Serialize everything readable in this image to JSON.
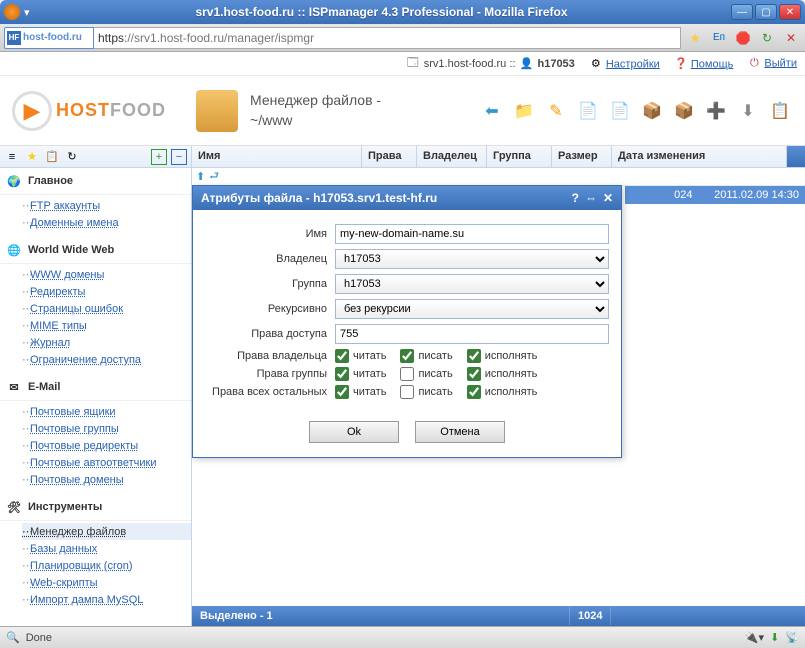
{
  "window": {
    "title": "srv1.host-food.ru :: ISPmanager 4.3 Professional - Mozilla Firefox"
  },
  "url": {
    "host": "host-food.ru",
    "protocol": "https",
    "path": "://srv1.host-food.ru/manager/ispmgr",
    "lang": "Еп"
  },
  "top": {
    "server": "srv1.host-food.ru ::",
    "user": "h17053",
    "settings": "Настройки",
    "help": "Помощь",
    "logout": "Выйти"
  },
  "header": {
    "brand1": "HOST",
    "brand2": "FOOD",
    "title": "Менеджер файлов -",
    "path": "~/www"
  },
  "grid": {
    "cols": {
      "name": "Имя",
      "rights": "Права",
      "owner": "Владелец",
      "group": "Группа",
      "size": "Размер",
      "date": "Дата изменения"
    },
    "row": {
      "size": "024",
      "date": "2011.02.09 14:30"
    },
    "status": {
      "selected": "Выделено - 1",
      "size": "1024"
    }
  },
  "sidebar": {
    "s1": {
      "title": "Главное",
      "i1": "FTP аккаунты",
      "i2": "Доменные имена"
    },
    "s2": {
      "title": "World Wide Web",
      "i1": "WWW домены",
      "i2": "Редиректы",
      "i3": "Страницы ошибок",
      "i4": "MIME типы",
      "i5": "Журнал",
      "i6": "Ограничение доступа"
    },
    "s3": {
      "title": "E-Mail",
      "i1": "Почтовые ящики",
      "i2": "Почтовые группы",
      "i3": "Почтовые редиректы",
      "i4": "Почтовые автоответчики",
      "i5": "Почтовые домены"
    },
    "s4": {
      "title": "Инструменты",
      "i1": "Менеджер файлов",
      "i2": "Базы данных",
      "i3": "Планировщик (cron)",
      "i4": "Web-скрипты",
      "i5": "Импорт дампа MySQL"
    }
  },
  "modal": {
    "title": "Атрибуты файла - h17053.srv1.test-hf.ru",
    "labels": {
      "name": "Имя",
      "owner": "Владелец",
      "group": "Группа",
      "recursive": "Рекурсивно",
      "perms": "Права доступа",
      "powner": "Права владельца",
      "pgroup": "Права группы",
      "pother": "Права всех остальных",
      "read": "читать",
      "write": "писать",
      "exec": "исполнять"
    },
    "values": {
      "name": "my-new-domain-name.su",
      "owner": "h17053",
      "group": "h17053",
      "recursive": "без рекурсии",
      "perms": "755"
    },
    "buttons": {
      "ok": "Ok",
      "cancel": "Отмена"
    }
  },
  "statusbar": {
    "text": "Done"
  }
}
